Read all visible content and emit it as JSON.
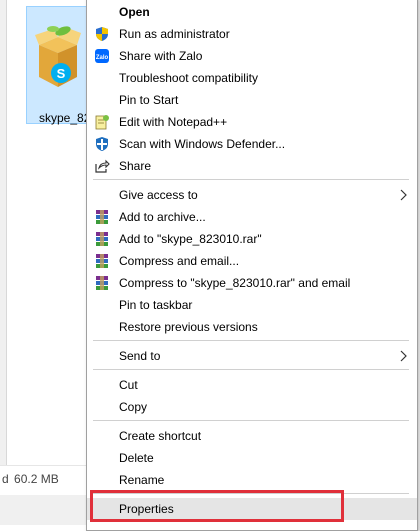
{
  "file": {
    "name": "skype_823010",
    "label_visible": "skype_82",
    "status_prefix": "d",
    "status_size": "60.2 MB"
  },
  "menu": {
    "items": [
      {
        "label": "Open",
        "icon": "none",
        "bold": true
      },
      {
        "label": "Run as administrator",
        "icon": "uac-shield-icon"
      },
      {
        "label": "Share with Zalo",
        "icon": "zalo-icon"
      },
      {
        "label": "Troubleshoot compatibility",
        "icon": "none"
      },
      {
        "label": "Pin to Start",
        "icon": "none"
      },
      {
        "label": "Edit with Notepad++",
        "icon": "notepadpp-icon"
      },
      {
        "label": "Scan with Windows Defender...",
        "icon": "defender-icon"
      },
      {
        "label": "Share",
        "icon": "share-icon"
      },
      {
        "label": "Give access to",
        "icon": "none",
        "submenu": true
      },
      {
        "label": "Add to archive...",
        "icon": "winrar-icon"
      },
      {
        "label": "Add to \"skype_823010.rar\"",
        "icon": "winrar-icon"
      },
      {
        "label": "Compress and email...",
        "icon": "winrar-icon"
      },
      {
        "label": "Compress to \"skype_823010.rar\" and email",
        "icon": "winrar-icon"
      },
      {
        "label": "Pin to taskbar",
        "icon": "none"
      },
      {
        "label": "Restore previous versions",
        "icon": "none"
      },
      {
        "label": "Send to",
        "icon": "none",
        "submenu": true
      },
      {
        "label": "Cut",
        "icon": "none"
      },
      {
        "label": "Copy",
        "icon": "none"
      },
      {
        "label": "Create shortcut",
        "icon": "none"
      },
      {
        "label": "Delete",
        "icon": "none"
      },
      {
        "label": "Rename",
        "icon": "none"
      },
      {
        "label": "Properties",
        "icon": "none",
        "highlighted": true
      }
    ]
  },
  "colors": {
    "highlight_border": "#e0303a",
    "selection_bg": "#cce8ff"
  }
}
